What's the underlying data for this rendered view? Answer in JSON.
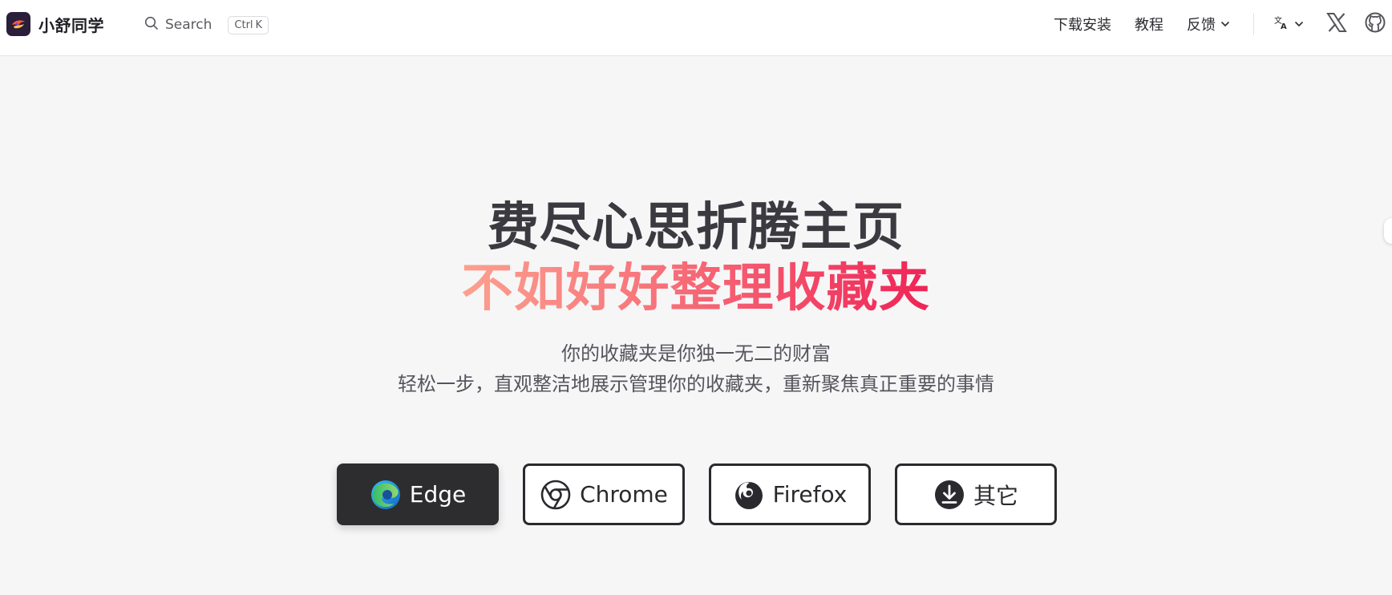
{
  "header": {
    "brand_name": "小舒同学",
    "search": {
      "label": "Search",
      "shortcut_mod": "Ctrl",
      "shortcut_key": "K"
    },
    "nav": {
      "download": "下载安装",
      "tutorial": "教程",
      "feedback": "反馈"
    },
    "icons": {
      "language": "translate-icon",
      "x": "x-twitter-icon",
      "github": "github-icon"
    }
  },
  "hero": {
    "headline": "费尽心思折腾主页",
    "headline_accent": "不如好好整理收藏夹",
    "tagline_1": "你的收藏夹是你独一无二的财富",
    "tagline_2": "轻松一步，直观整洁地展示管理你的收藏夹，重新聚焦真正重要的事情",
    "accent_gradient": [
      "#fca08e",
      "#ef2356"
    ]
  },
  "downloads": [
    {
      "label": "Edge",
      "icon": "edge-icon",
      "primary": true
    },
    {
      "label": "Chrome",
      "icon": "chrome-icon",
      "primary": false
    },
    {
      "label": "Firefox",
      "icon": "firefox-icon",
      "primary": false
    },
    {
      "label": "其它",
      "icon": "download-icon",
      "primary": false
    }
  ],
  "colors": {
    "background": "#f6f6f7",
    "primary_button": "#2d2d30",
    "text": "#3a3a40"
  }
}
